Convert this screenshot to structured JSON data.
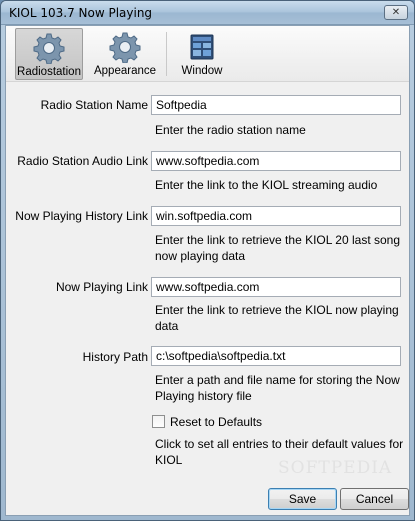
{
  "window": {
    "title": "KIOL 103.7 Now Playing",
    "close_glyph": "✕"
  },
  "toolbar": {
    "items": [
      {
        "label": "Radiostation",
        "icon": "gear-icon",
        "active": true
      },
      {
        "label": "Appearance",
        "icon": "gear-icon",
        "active": false
      },
      {
        "label": "Window",
        "icon": "window-icon",
        "active": false
      }
    ]
  },
  "form": {
    "radio_station_name": {
      "label": "Radio Station Name",
      "value": "Softpedia",
      "hint": "Enter the radio station name"
    },
    "audio_link": {
      "label": "Radio Station Audio Link",
      "value": "www.softpedia.com",
      "hint": "Enter the link to the KIOL streaming audio"
    },
    "history_link": {
      "label": "Now Playing History Link",
      "value": "win.softpedia.com",
      "hint": "Enter the link to retrieve the KIOL 20 last song now playing data"
    },
    "now_playing_link": {
      "label": "Now Playing Link",
      "value": "www.softpedia.com",
      "hint": "Enter the link to retrieve the KIOL now playing data"
    },
    "history_path": {
      "label": "History Path",
      "value": "c:\\softpedia\\softpedia.txt",
      "hint": "Enter a path and file name for storing the Now Playing history file"
    },
    "reset": {
      "label": "Reset to Defaults",
      "checked": false,
      "hint": "Click to set all entries to their default values for KIOL"
    }
  },
  "buttons": {
    "save": "Save",
    "cancel": "Cancel"
  },
  "watermark": "SOFTPEDIA"
}
